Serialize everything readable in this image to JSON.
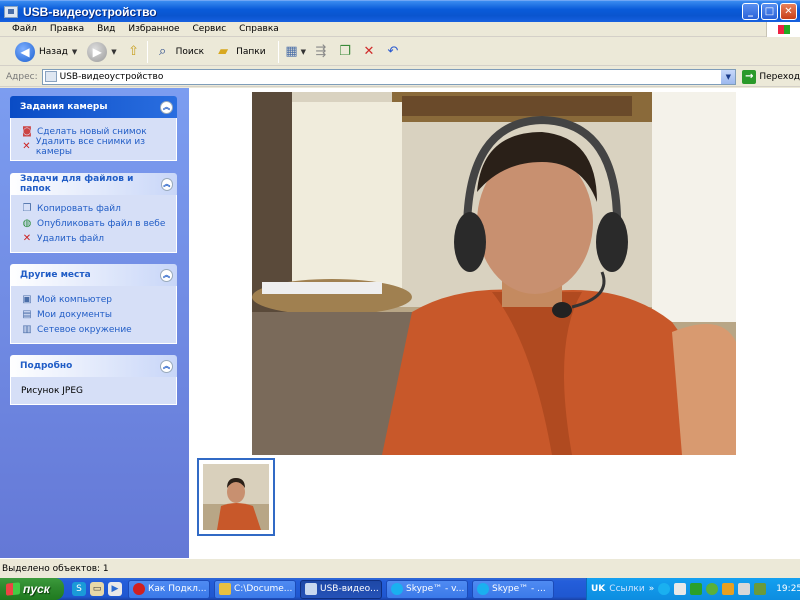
{
  "window": {
    "title": "USB-видеоустройство",
    "buttons": [
      "_",
      "□",
      "✕"
    ]
  },
  "menu": [
    "Файл",
    "Правка",
    "Вид",
    "Избранное",
    "Сервис",
    "Справка"
  ],
  "toolbar": {
    "back_label": "Назад",
    "search_label": "Поиск",
    "folders_label": "Папки"
  },
  "address": {
    "label": "Адрес:",
    "value": "USB-видеоустройство",
    "go_label": "Переход"
  },
  "sidebar": {
    "camera_tasks": {
      "title": "Задания камеры",
      "items": [
        "Сделать новый снимок",
        "Удалить все снимки из камеры"
      ]
    },
    "file_tasks": {
      "title": "Задачи для файлов и папок",
      "items": [
        "Копировать файл",
        "Опубликовать файл в вебе",
        "Удалить файл"
      ]
    },
    "other_places": {
      "title": "Другие места",
      "items": [
        "Мой компьютер",
        "Мои документы",
        "Сетевое окружение"
      ]
    },
    "details": {
      "title": "Подробно",
      "text": "Рисунок JPEG"
    }
  },
  "status": {
    "text": "Выделено объектов: 1"
  },
  "taskbar": {
    "start_label": "пуск",
    "buttons": [
      "Как Подкл...",
      "C:\\Docume...",
      "USB-видео...",
      "Skype™ - v...",
      "Skype™ - ..."
    ],
    "tray": {
      "lang": "UK",
      "links": "Ссылки",
      "clock": "19:25"
    }
  },
  "colors": {
    "titlebar": "#0A55CF",
    "sidepane": "#6478D6",
    "link": "#215DC6",
    "taskbar": "#245EDB",
    "start": "#2F8A2F"
  }
}
